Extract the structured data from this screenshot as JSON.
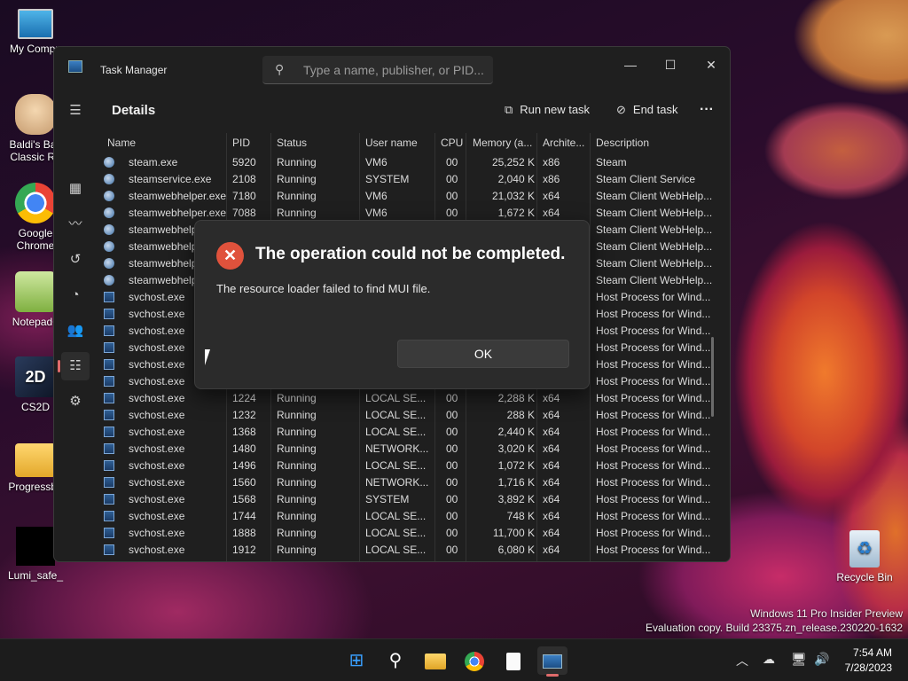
{
  "desktop": {
    "icons": [
      {
        "label": "My Compu",
        "icon": "monitor-icon"
      },
      {
        "label": "Baldi's Bas",
        "label2": "Classic Re",
        "icon": "baldi-icon"
      },
      {
        "label": "Google",
        "label2": "Chrome",
        "icon": "chrome-icon"
      },
      {
        "label": "Notepad+",
        "icon": "notepad-plus-icon"
      },
      {
        "label": "CS2D",
        "icon": "cs2d-icon"
      },
      {
        "label": "Progressba",
        "icon": "folder-icon"
      },
      {
        "label": "Lumi_safe_",
        "icon": "black-file-icon"
      },
      {
        "label": "Recycle Bin",
        "icon": "recycle-bin-icon"
      }
    ],
    "watermark_line1": "Windows 11 Pro Insider Preview",
    "watermark_line2": "Evaluation copy. Build 23375.zn_release.230220-1632"
  },
  "task_manager": {
    "title": "Task Manager",
    "search_placeholder": "Type a name, publisher, or PID...",
    "page_title": "Details",
    "run_new_task": "Run new task",
    "end_task": "End task",
    "more": "···",
    "columns": [
      "Name",
      "PID",
      "Status",
      "User name",
      "CPU",
      "Memory (a...",
      "Archite...",
      "Description"
    ],
    "rows": [
      {
        "icon": "steam",
        "name": "steam.exe",
        "pid": "5920",
        "status": "Running",
        "user": "VM6",
        "cpu": "00",
        "mem": "25,252 K",
        "arch": "x86",
        "desc": "Steam"
      },
      {
        "icon": "steam",
        "name": "steamservice.exe",
        "pid": "2108",
        "status": "Running",
        "user": "SYSTEM",
        "cpu": "00",
        "mem": "2,040 K",
        "arch": "x86",
        "desc": "Steam Client Service"
      },
      {
        "icon": "steam",
        "name": "steamwebhelper.exe",
        "pid": "7180",
        "status": "Running",
        "user": "VM6",
        "cpu": "00",
        "mem": "21,032 K",
        "arch": "x64",
        "desc": "Steam Client WebHelp..."
      },
      {
        "icon": "steam",
        "name": "steamwebhelper.exe",
        "pid": "7088",
        "status": "Running",
        "user": "VM6",
        "cpu": "00",
        "mem": "1,672 K",
        "arch": "x64",
        "desc": "Steam Client WebHelp..."
      },
      {
        "icon": "steam",
        "name": "steamwebhelper",
        "pid": "",
        "status": "",
        "user": "",
        "cpu": "",
        "mem": "",
        "arch": "",
        "desc": "Steam Client WebHelp..."
      },
      {
        "icon": "steam",
        "name": "steamwebhelper",
        "pid": "",
        "status": "",
        "user": "",
        "cpu": "",
        "mem": "",
        "arch": "",
        "desc": "Steam Client WebHelp..."
      },
      {
        "icon": "steam",
        "name": "steamwebhelper",
        "pid": "",
        "status": "",
        "user": "",
        "cpu": "",
        "mem": "",
        "arch": "",
        "desc": "Steam Client WebHelp..."
      },
      {
        "icon": "steam",
        "name": "steamwebhelper",
        "pid": "",
        "status": "",
        "user": "",
        "cpu": "",
        "mem": "",
        "arch": "",
        "desc": "Steam Client WebHelp..."
      },
      {
        "icon": "svc",
        "name": "svchost.exe",
        "pid": "",
        "status": "",
        "user": "",
        "cpu": "",
        "mem": "",
        "arch": "",
        "desc": "Host Process for Wind..."
      },
      {
        "icon": "svc",
        "name": "svchost.exe",
        "pid": "",
        "status": "",
        "user": "",
        "cpu": "",
        "mem": "",
        "arch": "",
        "desc": "Host Process for Wind..."
      },
      {
        "icon": "svc",
        "name": "svchost.exe",
        "pid": "",
        "status": "",
        "user": "",
        "cpu": "",
        "mem": "",
        "arch": "",
        "desc": "Host Process for Wind..."
      },
      {
        "icon": "svc",
        "name": "svchost.exe",
        "pid": "",
        "status": "",
        "user": "",
        "cpu": "",
        "mem": "",
        "arch": "",
        "desc": "Host Process for Wind..."
      },
      {
        "icon": "svc",
        "name": "svchost.exe",
        "pid": "",
        "status": "",
        "user": "",
        "cpu": "",
        "mem": "",
        "arch": "",
        "desc": "Host Process for Wind..."
      },
      {
        "icon": "svc",
        "name": "svchost.exe",
        "pid": "",
        "status": "",
        "user": "",
        "cpu": "",
        "mem": "",
        "arch": "",
        "desc": "Host Process for Wind..."
      },
      {
        "icon": "svc",
        "name": "svchost.exe",
        "pid": "1224",
        "status": "Running",
        "user": "LOCAL SE...",
        "cpu": "00",
        "mem": "2,288 K",
        "arch": "x64",
        "desc": "Host Process for Wind..."
      },
      {
        "icon": "svc",
        "name": "svchost.exe",
        "pid": "1232",
        "status": "Running",
        "user": "LOCAL SE...",
        "cpu": "00",
        "mem": "288 K",
        "arch": "x64",
        "desc": "Host Process for Wind..."
      },
      {
        "icon": "svc",
        "name": "svchost.exe",
        "pid": "1368",
        "status": "Running",
        "user": "LOCAL SE...",
        "cpu": "00",
        "mem": "2,440 K",
        "arch": "x64",
        "desc": "Host Process for Wind..."
      },
      {
        "icon": "svc",
        "name": "svchost.exe",
        "pid": "1480",
        "status": "Running",
        "user": "NETWORK...",
        "cpu": "00",
        "mem": "3,020 K",
        "arch": "x64",
        "desc": "Host Process for Wind..."
      },
      {
        "icon": "svc",
        "name": "svchost.exe",
        "pid": "1496",
        "status": "Running",
        "user": "LOCAL SE...",
        "cpu": "00",
        "mem": "1,072 K",
        "arch": "x64",
        "desc": "Host Process for Wind..."
      },
      {
        "icon": "svc",
        "name": "svchost.exe",
        "pid": "1560",
        "status": "Running",
        "user": "NETWORK...",
        "cpu": "00",
        "mem": "1,716 K",
        "arch": "x64",
        "desc": "Host Process for Wind..."
      },
      {
        "icon": "svc",
        "name": "svchost.exe",
        "pid": "1568",
        "status": "Running",
        "user": "SYSTEM",
        "cpu": "00",
        "mem": "3,892 K",
        "arch": "x64",
        "desc": "Host Process for Wind..."
      },
      {
        "icon": "svc",
        "name": "svchost.exe",
        "pid": "1744",
        "status": "Running",
        "user": "LOCAL SE...",
        "cpu": "00",
        "mem": "748 K",
        "arch": "x64",
        "desc": "Host Process for Wind..."
      },
      {
        "icon": "svc",
        "name": "svchost.exe",
        "pid": "1888",
        "status": "Running",
        "user": "LOCAL SE...",
        "cpu": "00",
        "mem": "11,700 K",
        "arch": "x64",
        "desc": "Host Process for Wind..."
      },
      {
        "icon": "svc",
        "name": "svchost.exe",
        "pid": "1912",
        "status": "Running",
        "user": "LOCAL SE...",
        "cpu": "00",
        "mem": "6,080 K",
        "arch": "x64",
        "desc": "Host Process for Wind..."
      }
    ]
  },
  "dialog": {
    "title": "The operation could not be completed.",
    "message": "The resource loader failed to find MUI file.",
    "ok": "OK"
  },
  "taskbar": {
    "time": "7:54 AM",
    "date": "7/28/2023"
  }
}
